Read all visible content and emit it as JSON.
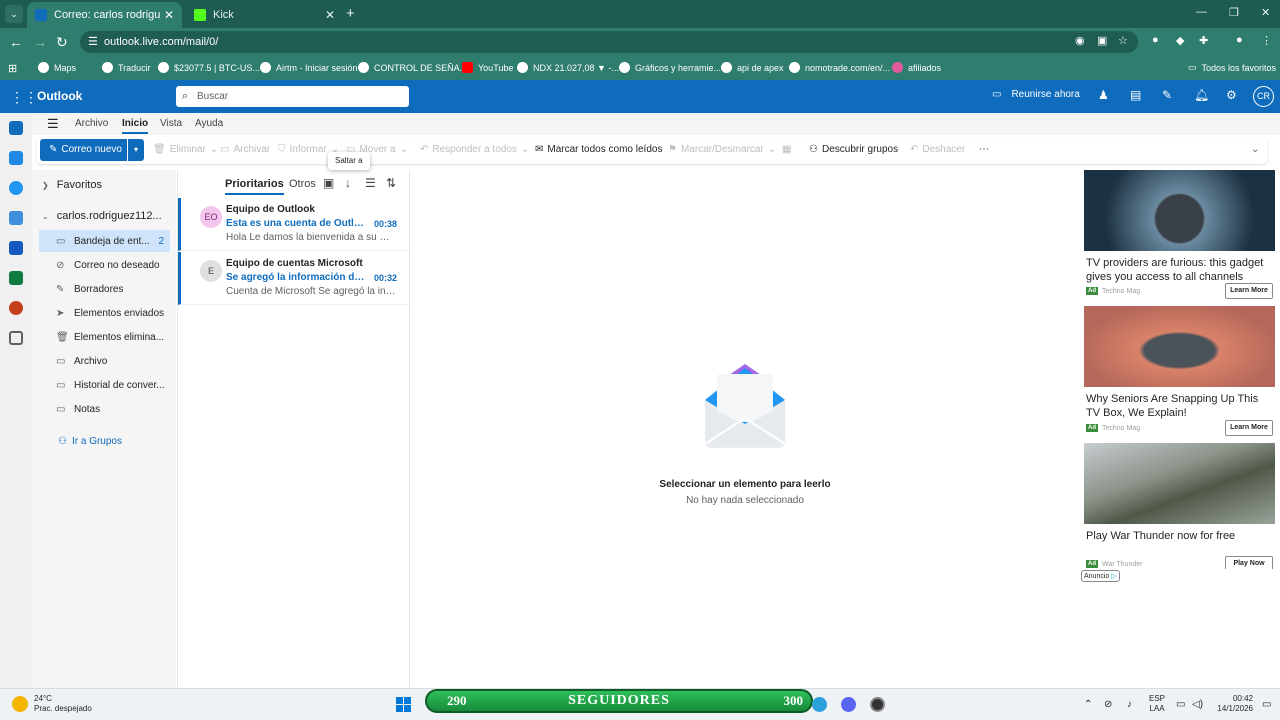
{
  "browser": {
    "tabs": [
      {
        "title": "Correo: carlos rodriguez - Outlook",
        "active": true
      },
      {
        "title": "Kick",
        "active": false
      }
    ],
    "url": "outlook.live.com/mail/0/",
    "bookmarks": [
      "Maps",
      "Traducir",
      "$23077.5 | BTC-US...",
      "Airtm - Iniciar sesión",
      "CONTROL DE SEÑA...",
      "YouTube",
      "NDX 21.027,08 ▼ -...",
      "Gráficos y herramie...",
      "api de apex",
      "nomotrade.com/en/...",
      "afiliados"
    ],
    "all_favorites": "Todos los favoritos"
  },
  "outlook": {
    "brand": "Outlook",
    "search_placeholder": "Buscar",
    "meet_now": "Reunirse ahora",
    "avatar_initials": "CR",
    "menu_tabs": [
      "Archivo",
      "Inicio",
      "Vista",
      "Ayuda"
    ],
    "selected_menu": "Inicio",
    "ribbon": {
      "new_mail": "Correo nuevo",
      "delete": "Eliminar",
      "archive": "Archivar",
      "report": "Informar",
      "move_to": "Mover a",
      "reply_all": "Responder a todos",
      "mark_all_read": "Marcar todos como leídos",
      "flag": "Marcar/Desmarcar",
      "discover_groups": "Descubrir grupos",
      "undo": "Deshacer"
    },
    "tooltip": "Saltar a",
    "folders": {
      "favorites": "Favoritos",
      "account": "carlos.rodriguez112...",
      "items": [
        {
          "label": "Bandeja de ent...",
          "count": "2",
          "icon": "inbox-icon"
        },
        {
          "label": "Correo no deseado",
          "count": "",
          "icon": "junk-icon"
        },
        {
          "label": "Borradores",
          "count": "",
          "icon": "drafts-icon"
        },
        {
          "label": "Elementos enviados",
          "count": "",
          "icon": "sent-icon"
        },
        {
          "label": "Elementos elimina...",
          "count": "",
          "icon": "trash-icon"
        },
        {
          "label": "Archivo",
          "count": "",
          "icon": "archive-icon"
        },
        {
          "label": "Historial de conver...",
          "count": "",
          "icon": "history-icon"
        },
        {
          "label": "Notas",
          "count": "",
          "icon": "notes-icon"
        }
      ],
      "groups_link": "Ir a Grupos"
    },
    "message_list": {
      "tabs": [
        "Prioritarios",
        "Otros"
      ],
      "messages": [
        {
          "initials": "EO",
          "from": "Equipo de Outlook",
          "subject": "Esta es una cuenta de Outlook....",
          "time": "00:38",
          "preview": "Hola Le damos la bienvenida a su Outl..."
        },
        {
          "initials": "E",
          "from": "Equipo de cuentas Microsoft",
          "subject": "Se agregó la información de se...",
          "time": "00:32",
          "preview": "Cuenta de Microsoft Se agregó la infor..."
        }
      ]
    },
    "reading_pane": {
      "title": "Seleccionar un elemento para leerlo",
      "subtitle": "No hay nada seleccionado"
    },
    "ads": [
      {
        "title": "TV providers are furious: this gadget gives you access to all channels",
        "source": "Techno Mag",
        "cta": "Learn More"
      },
      {
        "title": "Why Seniors Are Snapping Up This TV Box, We Explain!",
        "source": "Techno Mag",
        "cta": "Learn More"
      },
      {
        "title": "Play War Thunder now for free",
        "source": "War Thunder",
        "cta": "Play Now"
      }
    ],
    "ad_badge": "Ad",
    "ad_label": "Anuncio"
  },
  "taskbar": {
    "temp": "24°C",
    "weather": "Prac. despejado",
    "followers_left": "290",
    "followers_label": "SEGUIDORES",
    "followers_right": "300",
    "lang_top": "ESP",
    "lang_bottom": "LAA",
    "time": "00:42",
    "date": "14/1/2026"
  },
  "colors": {
    "accent": "#0f6cbd",
    "browser": "#2f7d6e",
    "kick": "#53fc18"
  }
}
